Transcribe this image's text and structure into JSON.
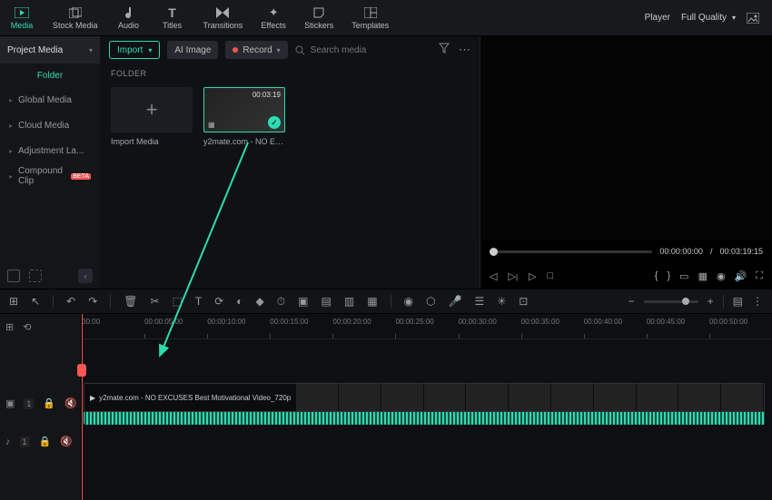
{
  "tabs": [
    {
      "label": "Media",
      "icon": "media-icon",
      "active": true
    },
    {
      "label": "Stock Media",
      "icon": "stock-icon"
    },
    {
      "label": "Audio",
      "icon": "audio-icon"
    },
    {
      "label": "Titles",
      "icon": "titles-icon"
    },
    {
      "label": "Transitions",
      "icon": "transitions-icon"
    },
    {
      "label": "Effects",
      "icon": "effects-icon"
    },
    {
      "label": "Stickers",
      "icon": "stickers-icon"
    },
    {
      "label": "Templates",
      "icon": "templates-icon"
    }
  ],
  "player": {
    "label": "Player",
    "quality": "Full Quality"
  },
  "sidebar": {
    "head": "Project Media",
    "folder": "Folder",
    "items": [
      {
        "label": "Global Media"
      },
      {
        "label": "Cloud Media"
      },
      {
        "label": "Adjustment La..."
      },
      {
        "label": "Compound Clip",
        "badge": "BETA"
      }
    ]
  },
  "mbar": {
    "import": "Import",
    "ai": "AI Image",
    "record": "Record",
    "search_ph": "Search media"
  },
  "folder_header": "FOLDER",
  "media": [
    {
      "name": "Import Media",
      "import": true
    },
    {
      "name": "y2mate.com - NO EXC...",
      "duration": "00:03:19",
      "selected": true
    }
  ],
  "preview": {
    "cur": "00:00:00:00",
    "sep": "/",
    "dur": "00:03:19:15"
  },
  "ruler": [
    "00:00",
    "00:00:05:00",
    "00:00:10:00",
    "00:00:15:00",
    "00:00:20:00",
    "00:00:25:00",
    "00:00:30:00",
    "00:00:35:00",
    "00:00:40:00",
    "00:00:45:00",
    "00:00:50:00"
  ],
  "tracks": {
    "video": "1",
    "audio": "1"
  },
  "clip": {
    "title": "y2mate.com - NO EXCUSES  Best Motivational Video_720p"
  }
}
